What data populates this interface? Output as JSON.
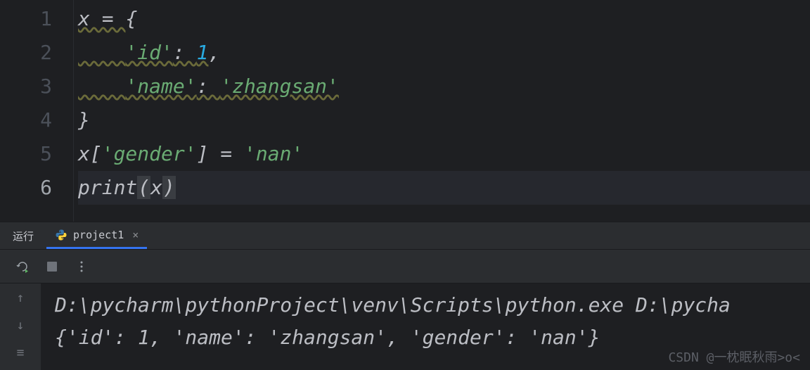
{
  "editor": {
    "lines": [
      "1",
      "2",
      "3",
      "4",
      "5",
      "6"
    ],
    "active_line": 6,
    "code": {
      "l1_pre": "x = ",
      "l1_brace": "{",
      "l2_indent": "    ",
      "l2_key": "'id'",
      "l2_colon": ": ",
      "l2_val": "1",
      "l2_comma": ",",
      "l3_indent": "    ",
      "l3_key": "'name'",
      "l3_colon": ": ",
      "l3_val": "'zhangsan'",
      "l4_brace": "}",
      "l5_var": "x",
      "l5_lb": "[",
      "l5_key": "'gender'",
      "l5_rb": "]",
      "l5_eq": " = ",
      "l5_val": "'nan'",
      "l6_fn": "print",
      "l6_lp": "(",
      "l6_arg": "x",
      "l6_rp": ")"
    }
  },
  "panel": {
    "run_label": "运行",
    "tab_label": "project1",
    "close": "×"
  },
  "output": {
    "line1": "D:\\pycharm\\pythonProject\\venv\\Scripts\\python.exe D:\\pycha",
    "line2": "{'id': 1, 'name': 'zhangsan', 'gender': 'nan'}"
  },
  "watermark": "CSDN @一枕眠秋雨>o<"
}
